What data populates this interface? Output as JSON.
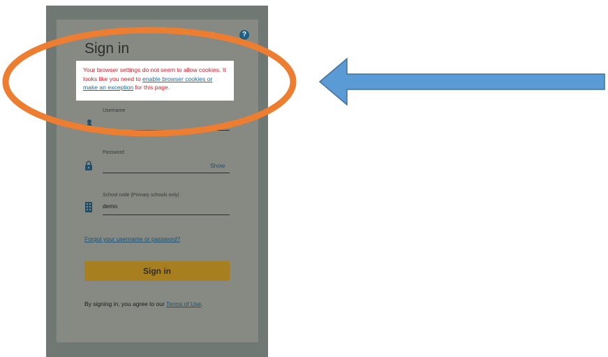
{
  "login": {
    "title": "Sign in",
    "help_icon": "?",
    "alert": {
      "text_before": "Your browser settings do not seem to allow cookies. It looks like you need to ",
      "link_text": "enable browser cookies or make an exception",
      "text_after": " for this page."
    },
    "username": {
      "label": "Username",
      "value": ""
    },
    "password": {
      "label": "Password",
      "value": "",
      "show_label": "Show"
    },
    "school_code": {
      "label": "School code (Primary schools only)",
      "value": "demo"
    },
    "forgot_link": "Forgot your username or password?",
    "signin_button": "Sign in",
    "agree_text": "By signing in, you agree to our ",
    "terms_link": "Terms of Use",
    "agree_end": "."
  },
  "annotation": {
    "ring_color": "#ed7d31",
    "arrow_fill": "#5b9bd5",
    "arrow_stroke": "#41719c"
  },
  "icons": [
    "help-icon",
    "person-icon",
    "lock-icon",
    "building-icon"
  ]
}
